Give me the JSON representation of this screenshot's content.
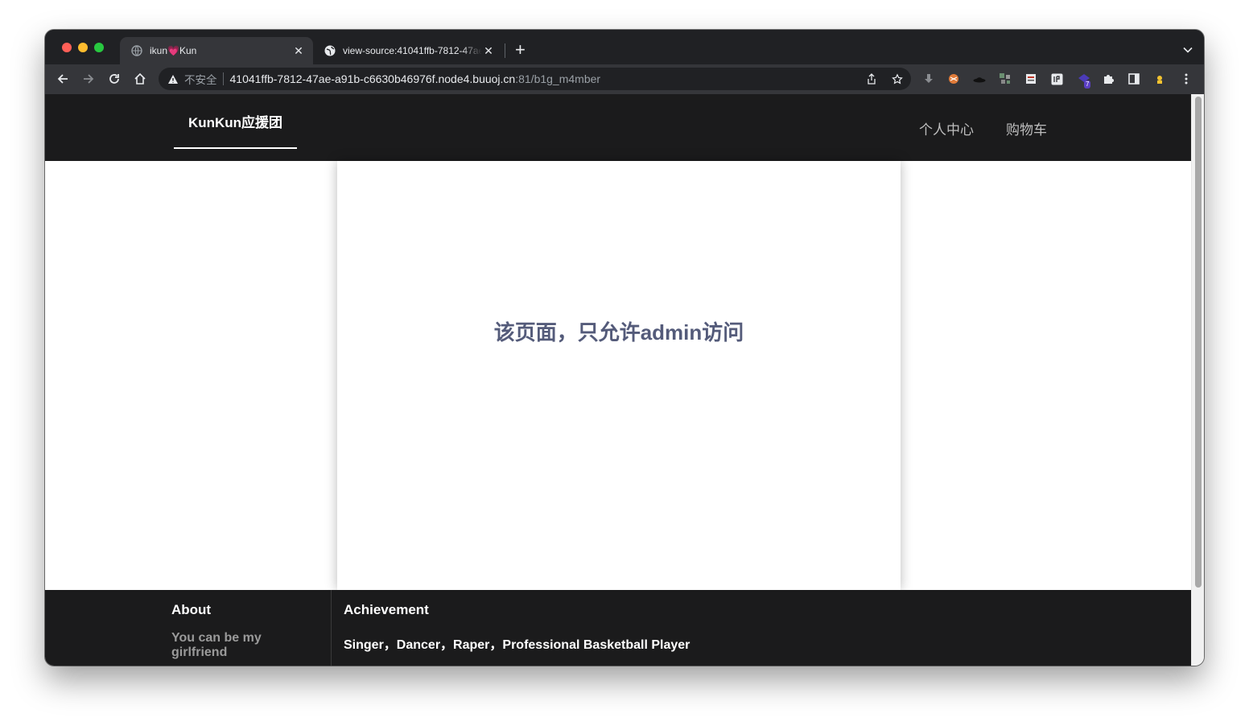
{
  "browser": {
    "tabs": [
      {
        "title": "ikun💗Kun",
        "active": true
      },
      {
        "title": "view-source:41041ffb-7812-47ae-a91b-c6630b46976f.node4.buuoj.cn:81/b1g_m4mber",
        "active": false
      }
    ],
    "address": {
      "security_label": "不安全",
      "host": "41041ffb-7812-47ae-a91b-c6630b46976f.node4.buuoj.cn",
      "rest": ":81/b1g_m4mber"
    },
    "extension_badge": "7"
  },
  "site": {
    "brand": "KunKun应援团",
    "nav": {
      "profile": "个人中心",
      "cart": "购物车"
    },
    "message": "该页面，只允许admin访问",
    "footer": {
      "about_title": "About",
      "about_text": "You can be my girlfriend",
      "achievement_title": "Achievement",
      "achievement_text": "Singer，Dancer，Raper，Professional Basketball Player"
    }
  },
  "colors": {
    "chrome_frame": "#202124",
    "chrome_toolbar": "#35363a",
    "site_dark": "#1b1b1c",
    "message_text": "#545b7a"
  }
}
